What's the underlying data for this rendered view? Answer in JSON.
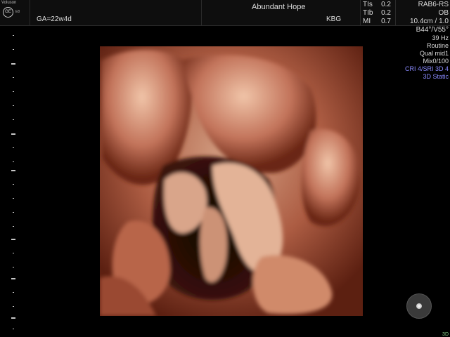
{
  "header": {
    "brand": "Voluson",
    "brand_mark": "GE",
    "model": "E8",
    "gestational_age": "GA=22w4d",
    "patient_name": "Abundant Hope",
    "operator": "KBG",
    "indices": [
      {
        "label": "TIs",
        "value": "0.2"
      },
      {
        "label": "TIb",
        "value": "0.2"
      },
      {
        "label": "MI",
        "value": "0.7"
      }
    ]
  },
  "scan_params": {
    "probe": "RAB6-RS",
    "application": "OB",
    "depth_ratio": "10.4cm / 1.0",
    "angle": "B44°/V55°",
    "frame_rate": "39 Hz",
    "preset": "Routine",
    "quality": "Qual mid1",
    "mix": "Mix0/100",
    "cri": "CRI 4/SRI 3D 4",
    "mode": "3D Static"
  },
  "footer": {
    "mode_badge": "3D"
  },
  "colors": {
    "background": "#000000",
    "skin_highlight": "#e8b89a",
    "skin_mid": "#b8654a",
    "skin_shadow": "#5a1e10",
    "accent_blue": "#8a8aff"
  },
  "icons": {
    "logo": "ge-logo-icon",
    "view_orb": "view-orientation-icon"
  }
}
